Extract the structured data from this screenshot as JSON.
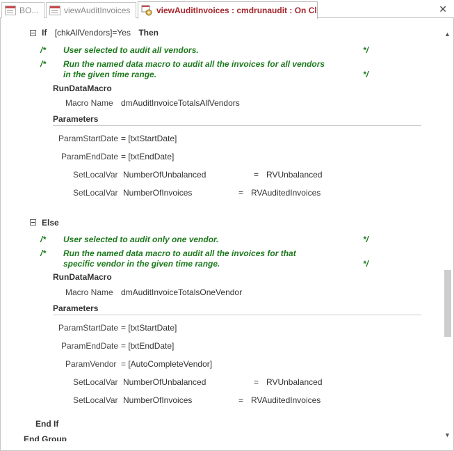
{
  "tabs": [
    {
      "label": "BO...",
      "icon": "form-icon",
      "active": false
    },
    {
      "label": "viewAuditInvoices",
      "icon": "form-icon",
      "active": false
    },
    {
      "label": "viewAuditInvoices : cmdrunaudit : On Click",
      "icon": "macro-icon",
      "active": true
    }
  ],
  "close_label": "✕",
  "macro": {
    "if_block": {
      "keyword_if": "If",
      "condition": "[chkAllVendors]=Yes",
      "keyword_then": "Then",
      "comments": [
        {
          "open": "/*",
          "lines": [
            "User selected to audit all vendors."
          ],
          "close": "*/"
        },
        {
          "open": "/*",
          "lines": [
            "Run the named data macro to audit all the invoices for all vendors",
            "in the given time range."
          ],
          "close": "*/"
        }
      ],
      "action": "RunDataMacro",
      "macro_name_label": "Macro Name",
      "macro_name_value": "dmAuditInvoiceTotalsAllVendors",
      "parameters_label": "Parameters",
      "parameters": [
        {
          "name": "ParamStartDate",
          "value": "= [txtStartDate]"
        },
        {
          "name": "ParamEndDate",
          "value": "= [txtEndDate]"
        }
      ],
      "set_local_vars": [
        {
          "label": "SetLocalVar",
          "name": "NumberOfUnbalanced",
          "eq": "=",
          "value": "RVUnbalanced"
        },
        {
          "label": "SetLocalVar",
          "name": "NumberOfInvoices",
          "eq": "=",
          "value": "RVAuditedInvoices"
        }
      ]
    },
    "else_block": {
      "keyword_else": "Else",
      "comments": [
        {
          "open": "/*",
          "lines": [
            "User selected to audit only one vendor."
          ],
          "close": "*/"
        },
        {
          "open": "/*",
          "lines": [
            "Run the named data macro to audit all the invoices for that",
            "specific vendor in the given time range."
          ],
          "close": "*/"
        }
      ],
      "action": "RunDataMacro",
      "macro_name_label": "Macro Name",
      "macro_name_value": "dmAuditInvoiceTotalsOneVendor",
      "parameters_label": "Parameters",
      "parameters": [
        {
          "name": "ParamStartDate",
          "value": "= [txtStartDate]"
        },
        {
          "name": "ParamEndDate",
          "value": "= [txtEndDate]"
        },
        {
          "name": "ParamVendor",
          "value": "= [AutoCompleteVendor]"
        }
      ],
      "set_local_vars": [
        {
          "label": "SetLocalVar",
          "name": "NumberOfUnbalanced",
          "eq": "=",
          "value": "RVUnbalanced"
        },
        {
          "label": "SetLocalVar",
          "name": "NumberOfInvoices",
          "eq": "=",
          "value": "RVAuditedInvoices"
        }
      ]
    },
    "end_if": "End If",
    "end_group": "End Group"
  },
  "colors": {
    "comment": "#1e7a1e",
    "active_tab": "#a4262c"
  }
}
